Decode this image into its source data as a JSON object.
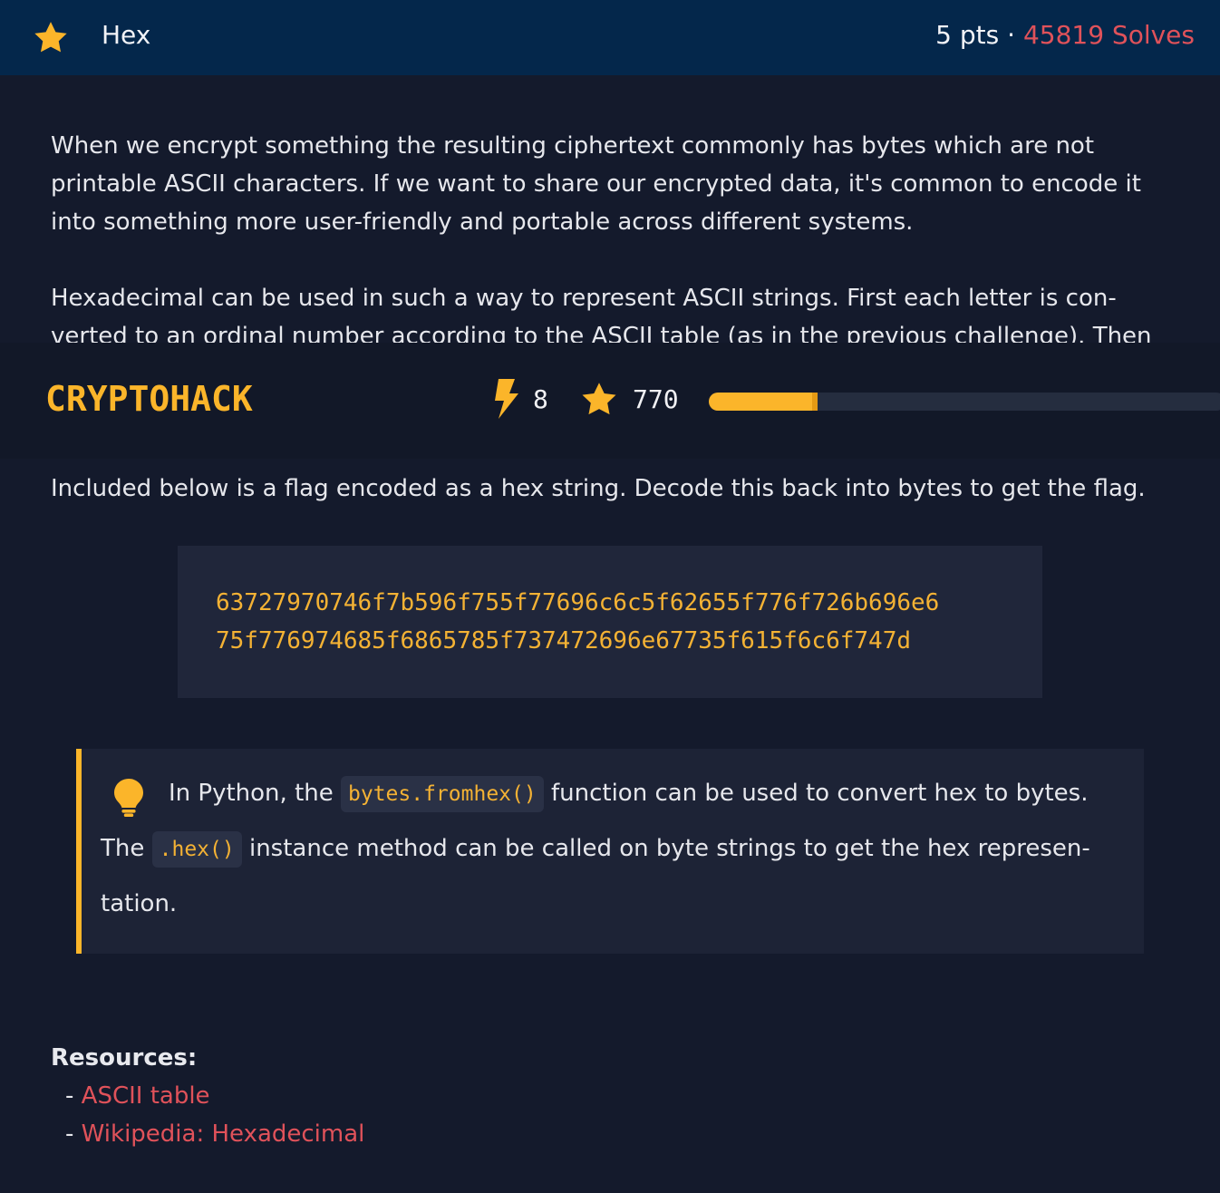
{
  "challenge": {
    "title": "Hex",
    "points": "5 pts",
    "separator": "·",
    "solves": "45819 Solves"
  },
  "description": {
    "p1": "When we encrypt something the resulting ciphertext commonly has bytes which are not printable ASCII characters. If we want to share our encrypted data, it's common to encode it into something more user-friendly and portable across different systems.",
    "p2": "Hexadecimal can be used in such a way to represent ASCII strings. First each letter is con­verted to an ordinal number according to the ASCII table (as in the previous challenge). Then",
    "p3": "Included below is a flag encoded as a hex string. Decode this back into bytes to get the flag."
  },
  "navbar": {
    "brand": "CRYPTOHACK",
    "streak_icon": "lightning-bolt-icon",
    "streak": "8",
    "score_icon": "star-icon",
    "score": "770",
    "progress_fraction": 0.21
  },
  "hex_block": {
    "line1": "63727970746f7b596f755f77696c6c5f62655f776f726b696e6",
    "line2": "75f776974685f6865785f737472696e67735f615f6c6f747d"
  },
  "hint": {
    "icon": "lightbulb-icon",
    "t1": "In Python, the",
    "code1": "bytes.fromhex()",
    "t2": "function can be used to convert hex to bytes.",
    "t3": "The",
    "code2": ".hex()",
    "t4": "instance method can be called on byte strings to get the hex represen-",
    "t5": "tation."
  },
  "resources": {
    "title": "Resources:",
    "dash": "-",
    "items": [
      "ASCII table",
      "Wikipedia: Hexadecimal"
    ]
  },
  "colors": {
    "accent": "#fbb52a",
    "link": "#e0525a",
    "header_bg": "#04274b",
    "page_bg": "#141a2c"
  }
}
